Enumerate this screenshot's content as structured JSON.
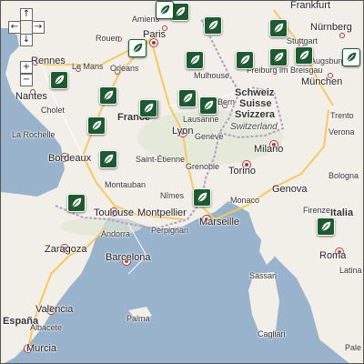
{
  "controls": {
    "pan_up": "↑",
    "pan_left": "←",
    "pan_right": "→",
    "pan_down": "↓",
    "zoom_in": "+",
    "zoom_out": "−"
  },
  "colors": {
    "sea": "#99b3cc",
    "land": "#f2efe9",
    "marker_fill": "#1d5a2f",
    "road_major": "#f7c95e",
    "road_minor": "#ffffff",
    "border": "#b39cc9"
  },
  "countries": [
    "France",
    "Schweiz",
    "Suisse",
    "Svizzera",
    "Switzerland",
    "Italia",
    "España"
  ],
  "cities": [
    "Amiens",
    "Rouen",
    "Paris",
    "Frankfurt",
    "Nürnberg",
    "Stuttgart",
    "Augsburg",
    "München",
    "Rennes",
    "Le Mans",
    "Orléans",
    "Nantes",
    "Cholet",
    "Freiburg im Breisgau",
    "Mulhouse",
    "Bern",
    "Lausanne",
    "Genève",
    "Lyon",
    "Saint-Étienne",
    "Grenoble",
    "La Rochelle",
    "Bordeaux",
    "Montauban",
    "Toulouse",
    "Montpellier",
    "Nîmes",
    "Marseille",
    "Monaco",
    "Milano",
    "Torino",
    "Genova",
    "Bologna",
    "Firenze",
    "Trento",
    "Verona",
    "Andorra",
    "Perpignan",
    "Zaragoza",
    "Barcelona",
    "Valencia",
    "Albacete",
    "Murcia",
    "Palma",
    "Sassari",
    "Cagliari",
    "Roma",
    "Latina",
    "Pale"
  ],
  "markers": [
    {
      "type": "filled"
    },
    {
      "type": "filled"
    },
    {
      "type": "filled"
    },
    {
      "type": "outline"
    },
    {
      "type": "filled"
    },
    {
      "type": "filled"
    },
    {
      "type": "filled"
    },
    {
      "type": "filled"
    },
    {
      "type": "outline"
    },
    {
      "type": "filled"
    },
    {
      "type": "filled"
    },
    {
      "type": "filled"
    },
    {
      "type": "filled"
    },
    {
      "type": "filled"
    },
    {
      "type": "filled"
    },
    {
      "type": "filled"
    },
    {
      "type": "filled"
    },
    {
      "type": "filled"
    },
    {
      "type": "filled"
    },
    {
      "type": "outline"
    },
    {
      "type": "filled"
    }
  ]
}
